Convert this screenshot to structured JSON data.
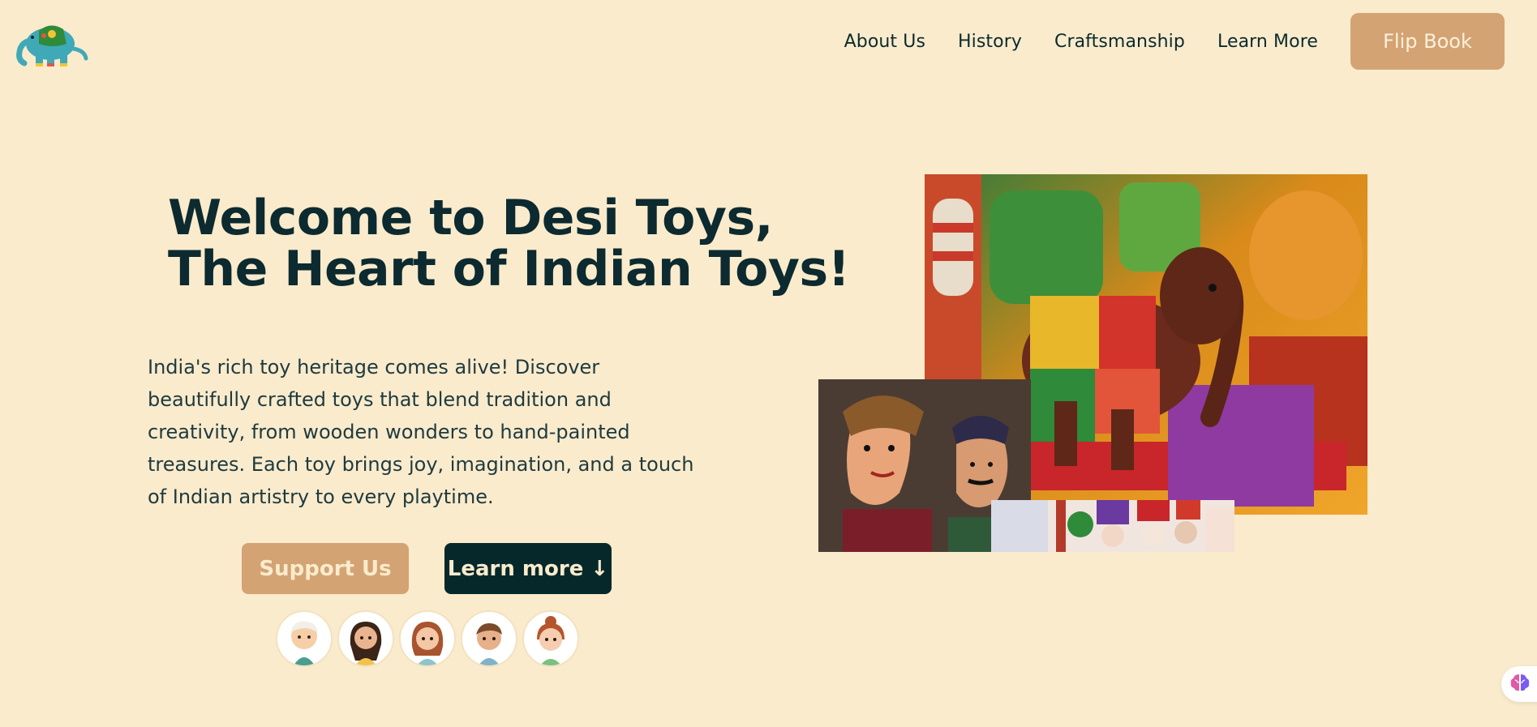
{
  "nav": {
    "items": [
      {
        "label": "About Us"
      },
      {
        "label": "History"
      },
      {
        "label": "Craftsmanship"
      },
      {
        "label": "Learn More"
      }
    ],
    "cta_label": "Flip Book"
  },
  "hero": {
    "title_line1": "Welcome to Desi Toys,",
    "title_line2": "The Heart of Indian Toys!",
    "description": "India's rich toy heritage comes alive! Discover beautifully crafted toys that blend tradition and creativity, from wooden wonders to hand-painted treasures. Each toy brings joy, imagination, and a touch of Indian artistry to every playtime.",
    "support_label": "Support Us",
    "learn_label": "Learn more ↓"
  },
  "colors": {
    "background": "#f9ebcc",
    "accent": "#d4a373",
    "dark": "#06282b"
  },
  "icons": {
    "logo": "elephant-logo-icon",
    "assistant": "brain-icon"
  }
}
